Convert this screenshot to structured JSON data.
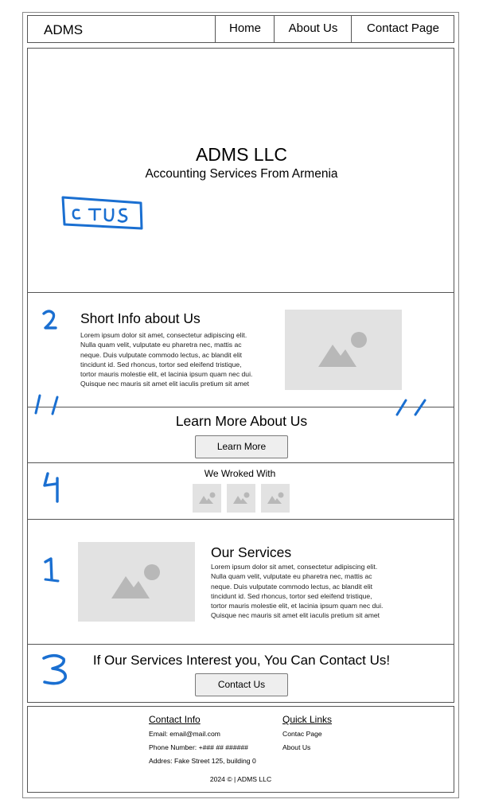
{
  "header": {
    "logo": "ADMS",
    "nav": [
      "Home",
      "About Us",
      "Contact Page"
    ]
  },
  "hero": {
    "title": "ADMS LLC",
    "subtitle": "Accounting Services From Armenia",
    "annotation": "CT US"
  },
  "about": {
    "title": "Short Info about Us",
    "body": [
      "Lorem ipsum dolor sit amet, consectetur adipiscing elit.",
      "Nulla quam velit, vulputate eu pharetra nec, mattis ac",
      "neque. Duis vulputate commodo lectus, ac blandit elit",
      "tincidunt id. Sed rhoncus, tortor sed eleifend tristique,",
      "tortor mauris molestie elit, et lacinia ipsum quam nec dui.",
      "Quisque nec mauris sit amet elit iaculis pretium sit amet"
    ],
    "annotation": "2"
  },
  "learn_more": {
    "title": "Learn More About Us",
    "button": "Learn More"
  },
  "partners": {
    "title": "We Wroked With",
    "annotation": "4"
  },
  "services": {
    "title": "Our Services",
    "body": [
      "Lorem ipsum dolor sit amet, consectetur adipiscing elit.",
      "Nulla quam velit, vulputate eu pharetra nec, mattis ac",
      "neque. Duis vulputate commodo lectus, ac blandit elit",
      "tincidunt id. Sed rhoncus, tortor sed eleifend tristique,",
      "tortor mauris molestie elit, et lacinia ipsum quam nec dui.",
      "Quisque nec mauris sit amet elit iaculis pretium sit amet"
    ],
    "annotation": "1"
  },
  "cta": {
    "title": "If Our Services Interest you, You Can Contact Us!",
    "button": "Contact Us",
    "annotation": "3"
  },
  "footer": {
    "contact_title": "Contact Info",
    "email": "Email: email@mail.com",
    "phone": "Phone Number: +### ## ######",
    "address": "Addres: Fake Street 125, building 0",
    "links_title": "Quick Links",
    "links": [
      "Contac Page",
      "About Us"
    ],
    "copyright": "2024 © | ADMS LLC"
  },
  "colors": {
    "annotation": "#1a6fd1",
    "placeholder": "#e2e2e2",
    "placeholder_icon": "#b8b8b8"
  }
}
